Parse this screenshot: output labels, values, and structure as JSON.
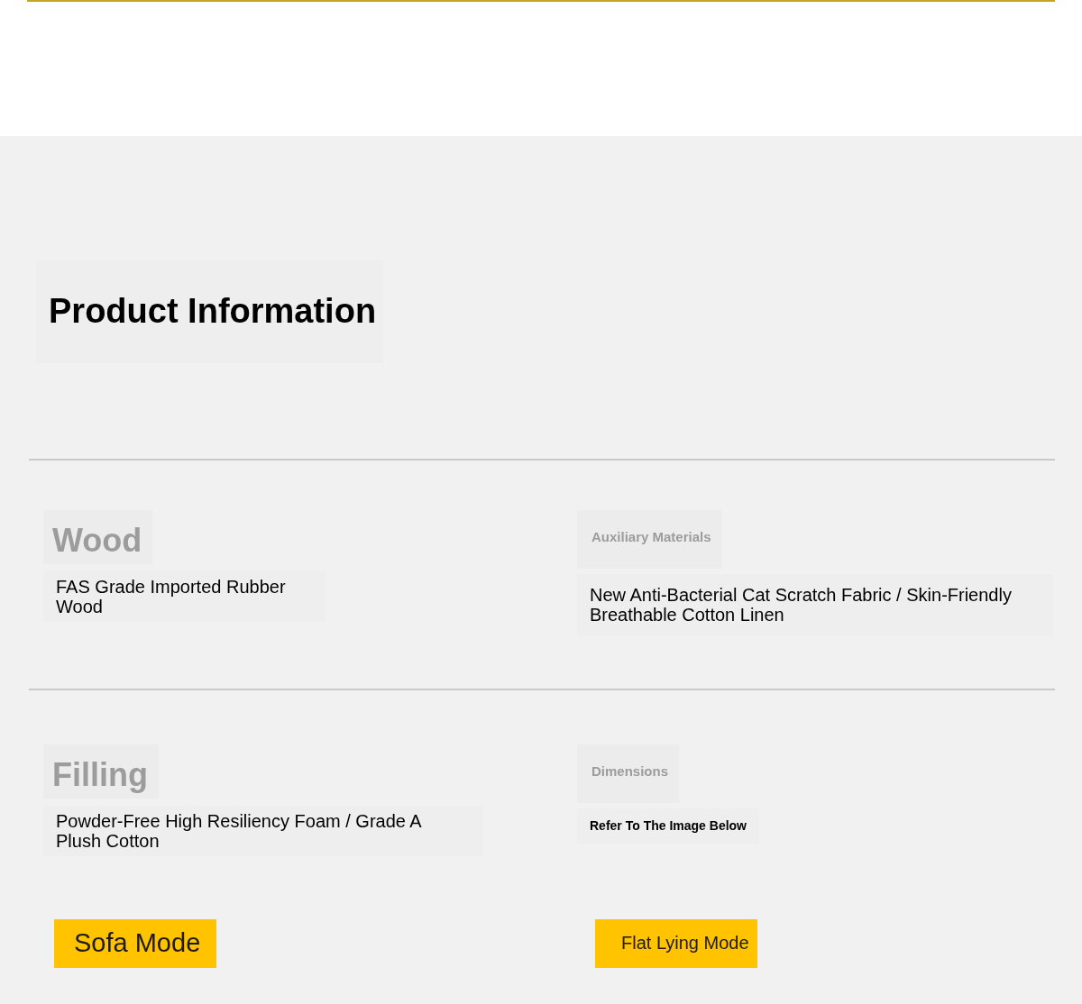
{
  "heading": "Product Information",
  "specs": [
    [
      {
        "label": "Wood",
        "value": "FAS Grade Imported Rubber Wood"
      },
      {
        "label": "Auxiliary Materials",
        "value": "New Anti-Bacterial Cat Scratch Fabric / Skin-Friendly Breathable Cotton Linen"
      }
    ],
    [
      {
        "label": "Filling",
        "value": "Powder-Free High Resiliency Foam / Grade A Plush Cotton"
      },
      {
        "label": "Dimensions",
        "value": "Refer To The Image Below"
      }
    ]
  ],
  "modes": [
    "Sofa Mode",
    "Flat Lying Mode"
  ]
}
